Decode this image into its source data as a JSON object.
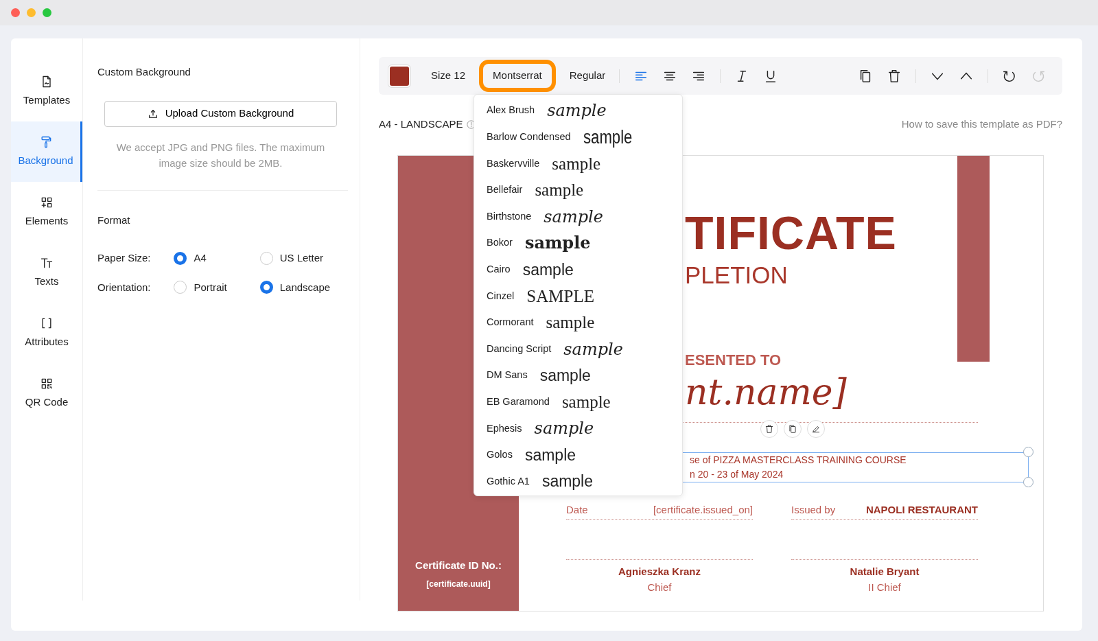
{
  "window": {
    "controls": [
      {
        "color": "#fe5f57"
      },
      {
        "color": "#febc2e"
      },
      {
        "color": "#28c840"
      }
    ]
  },
  "sidebar": {
    "items": [
      {
        "label": "Templates",
        "selected": false
      },
      {
        "label": "Background",
        "selected": true
      },
      {
        "label": "Elements",
        "selected": false
      },
      {
        "label": "Texts",
        "selected": false
      },
      {
        "label": "Attributes",
        "selected": false
      },
      {
        "label": "QR Code",
        "selected": false
      }
    ]
  },
  "panel": {
    "title": "Custom Background",
    "upload_button": "Upload Custom Background",
    "note": "We accept JPG and PNG files. The maximum image size should be 2MB.",
    "format_title": "Format",
    "fields": [
      {
        "label": "Paper Size:",
        "options": [
          {
            "label": "A4",
            "selected": true
          },
          {
            "label": "US Letter",
            "selected": false
          }
        ]
      },
      {
        "label": "Orientation:",
        "options": [
          {
            "label": "Portrait",
            "selected": false
          },
          {
            "label": "Landscape",
            "selected": true
          }
        ]
      }
    ]
  },
  "toolbar": {
    "size": "Size 12",
    "font": {
      "label": "Montserrat",
      "open": true
    },
    "weight": "Regular",
    "align": [
      {
        "selected": true
      },
      {
        "selected": false
      },
      {
        "selected": false
      }
    ],
    "history": [
      {
        "disabled": false
      },
      {
        "disabled": true
      }
    ]
  },
  "font_menu": {
    "items": [
      {
        "name": "Alex Brush",
        "sample": "sample",
        "kind": "script"
      },
      {
        "name": "Barlow Condensed",
        "sample": "sample",
        "kind": "condensed"
      },
      {
        "name": "Baskervville",
        "sample": "sample",
        "kind": "serif"
      },
      {
        "name": "Bellefair",
        "sample": "sample",
        "kind": "serif"
      },
      {
        "name": "Birthstone",
        "sample": "sample",
        "kind": "script"
      },
      {
        "name": "Bokor",
        "sample": "sample",
        "kind": "blackletter"
      },
      {
        "name": "Cairo",
        "sample": "sample",
        "kind": "sans"
      },
      {
        "name": "Cinzel",
        "sample": "SAMPLE",
        "kind": "serif"
      },
      {
        "name": "Cormorant",
        "sample": "sample",
        "kind": "serif"
      },
      {
        "name": "Dancing Script",
        "sample": "sample",
        "kind": "script"
      },
      {
        "name": "DM Sans",
        "sample": "sample",
        "kind": "sans"
      },
      {
        "name": "EB Garamond",
        "sample": "sample",
        "kind": "serif"
      },
      {
        "name": "Ephesis",
        "sample": "sample",
        "kind": "script"
      },
      {
        "name": "Golos",
        "sample": "sample",
        "kind": "sans"
      },
      {
        "name": "Gothic A1",
        "sample": "sample",
        "kind": "sans"
      }
    ]
  },
  "canvas": {
    "format": "A4 - LANDSCAPE",
    "help_link": "How to save this template as PDF?"
  },
  "certificate": {
    "title": "TIFICATE",
    "subtitle": "PLETION",
    "presented": "ESENTED TO",
    "recipient": "nt.name]",
    "selected_text": {
      "selected": true,
      "lines": [
        "se of PIZZA MASTERCLASS TRAINING COURSE",
        "n 20 - 23 of May 2024"
      ]
    },
    "date_label": "Date",
    "date_value": "[certificate.issued_on]",
    "issuer_label": "Issued by",
    "issuer": "NAPOLI RESTAURANT",
    "signatures": [
      {
        "name": "Agnieszka Kranz",
        "role": "Chief"
      },
      {
        "name": "Natalie Bryant",
        "role": "II Chief"
      }
    ],
    "id_label": "Certificate ID No.:",
    "id_value": "[certificate.uuid]"
  }
}
